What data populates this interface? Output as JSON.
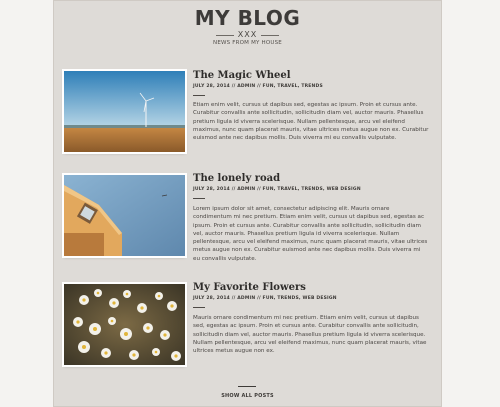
{
  "header": {
    "title": "MY BLOG",
    "ornament": "XXX",
    "subtitle": "NEWS FROM MY HOUSE"
  },
  "posts": [
    {
      "title": "The Magic Wheel",
      "meta": "JULY 28, 2014 // ADMIN // FUN, TRAVEL, TRENDS",
      "body": "Etiam enim velit, cursus ut dapibus sed, egestas ac ipsum. Proin et cursus ante. Curabitur convallis ante sollicitudin, sollicitudin diam vel, auctor mauris. Phasellus pretium ligula id viverra scelerisque. Nullam pellentesque, arcu vel eleifend maximus, nunc quam placerat mauris, vitae ultrices metus augue non ex. Curabitur euismod ante nec dapibus mollis. Duis viverra mi eu convallis vulputate.",
      "image": "windmill-field-photo"
    },
    {
      "title": "The lonely road",
      "meta": "JULY 28, 2014 // ADMIN // FUN, TRAVEL, TRENDS, WEB DESIGN",
      "body": "Lorem ipsum dolor sit amet, consectetur adipiscing elit. Mauris ornare condimentum mi nec pretium. Etiam enim velit, cursus ut dapibus sed, egestas ac ipsum. Proin et cursus ante. Curabitur convallis ante sollicitudin, sollicitudin diam vel, auctor mauris. Phasellus pretium ligula id viverra scelerisque. Nullam pellentesque, arcu vel eleifend maximus, nunc quam placerat mauris, vitae ultrices metus augue non ex. Curabitur euismod ante nec dapibus mollis. Duis viverra mi eu convallis vulputate.",
      "image": "building-sky-photo"
    },
    {
      "title": "My Favorite Flowers",
      "meta": "JULY 28, 2014 // ADMIN // FUN, TRENDS, WEB DESIGN",
      "body": "Mauris ornare condimentum mi nec pretium. Etiam enim velit, cursus ut dapibus sed, egestas ac ipsum. Proin et cursus ante. Curabitur convallis ante sollicitudin, sollicitudin diam vel, auctor mauris. Phasellus pretium ligula id viverra scelerisque. Nullam pellentesque, arcu vel eleifend maximus, nunc quam placerat mauris, vitae ultrices metus augue non ex.",
      "image": "daisies-photo"
    }
  ],
  "footer": {
    "show_all_label": "SHOW ALL POSTS"
  }
}
